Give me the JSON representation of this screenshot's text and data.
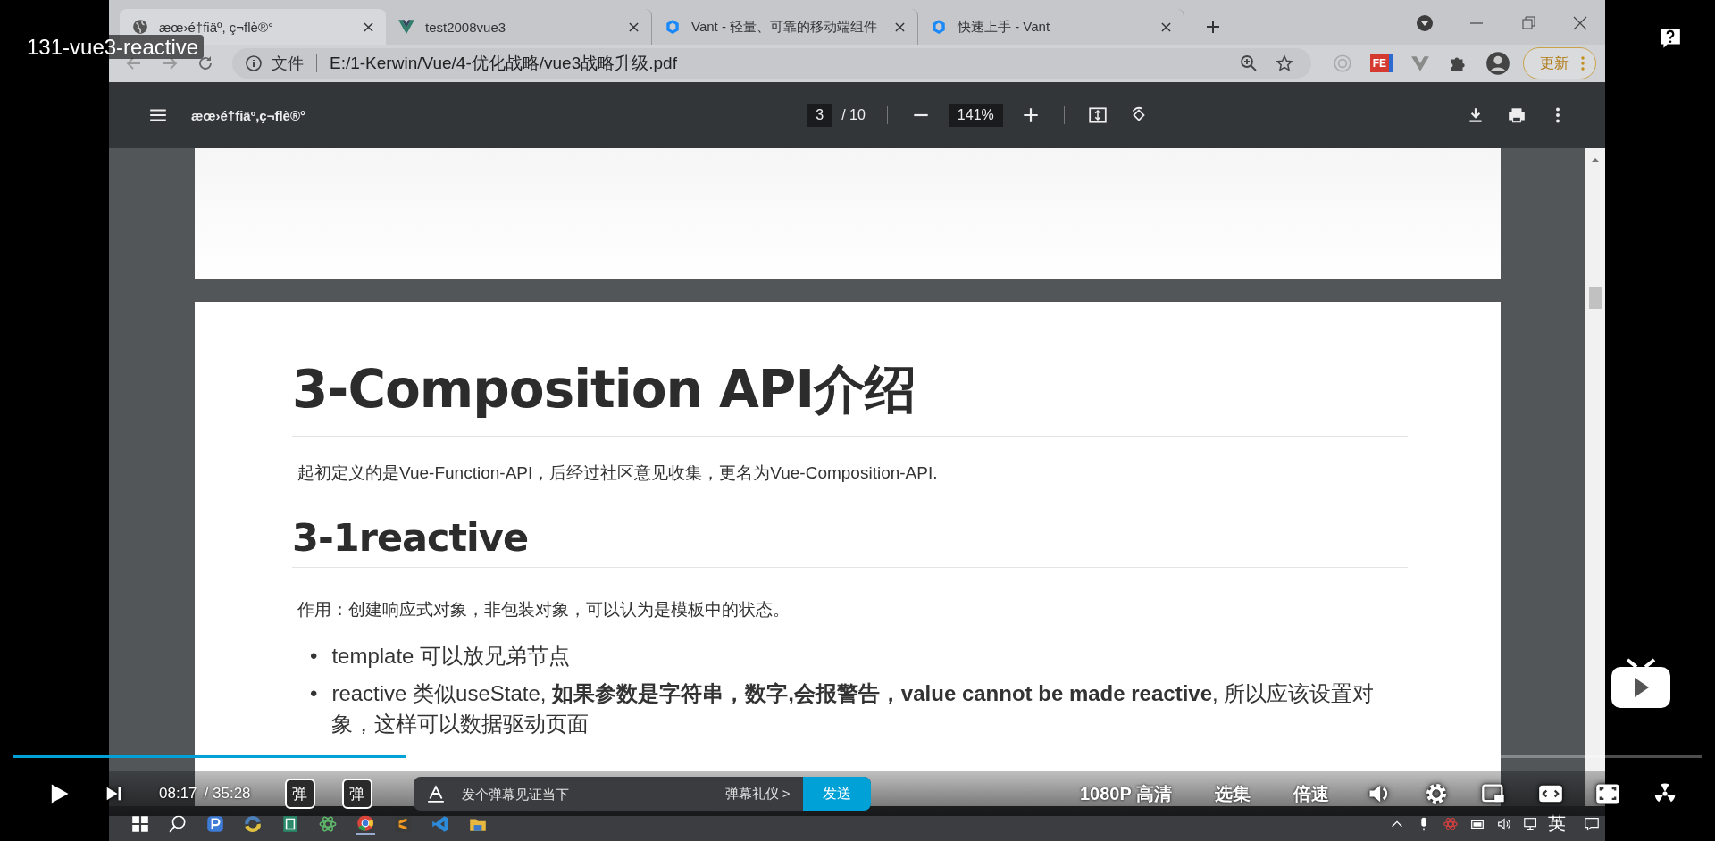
{
  "video": {
    "title": "131-vue3-reactive",
    "progress": {
      "level": 0.233
    },
    "current_time": "08:17",
    "duration": "/  35:28",
    "danmaku_toggle": "弹",
    "danmaku_settings": "弹",
    "danmaku_placeholder": "发个弹幕见证当下",
    "danmaku_etiquette": "弹幕礼仪 >",
    "send": "发送",
    "quality": "1080P 高清",
    "episodes": "选集",
    "speed": "倍速"
  },
  "browser": {
    "tabs": [
      {
        "title": "æœ›é†fiäº, ç¬flè®°",
        "kind": "page",
        "selected": true
      },
      {
        "title": "test2008vue3",
        "kind": "vue",
        "selected": false
      },
      {
        "title": "Vant - 轻量、可靠的移动端组件",
        "kind": "vant",
        "selected": false
      },
      {
        "title": "快速上手 - Vant",
        "kind": "vant",
        "selected": false
      }
    ],
    "address": {
      "prefix": "文件",
      "url": "E:/1-Kerwin/Vue/4-优化战略/vue3战略升级.pdf"
    },
    "extension_label": "FE",
    "update_button": "更新"
  },
  "pdf": {
    "title": "æœ›é†fiäº,ç¬flè®°",
    "page": "3",
    "page_count": "/ 10",
    "zoom": "141%",
    "heading": "3-Composition API介绍",
    "intro": "起初定义的是Vue-Function-API，后经过社区意见收集，更名为Vue-Composition-API.",
    "subheading": "3-1reactive",
    "body": "作用：创建响应式对象，非包装对象，可以认为是模板中的状态。",
    "bullets": [
      {
        "marker": "•",
        "text": "template 可以放兄弟节点"
      },
      {
        "marker": "•",
        "text": "reactive 类似useState, **如果参数是字符串，数字,会报警告，value cannot be made reactive**, 所以应该设置对象，这样可以数据驱动页面"
      }
    ]
  },
  "taskbar": {
    "ime": "英"
  }
}
